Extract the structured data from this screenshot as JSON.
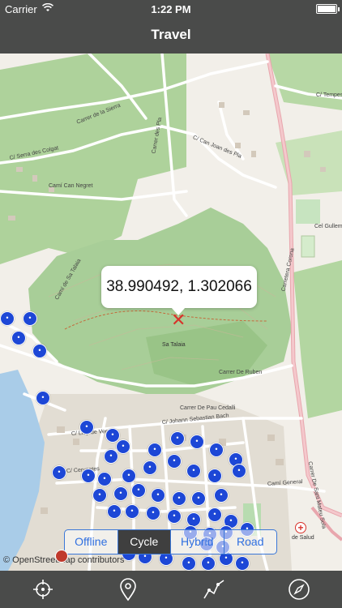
{
  "status_bar": {
    "carrier": "Carrier",
    "time": "1:22 PM",
    "battery_level": 1.0
  },
  "nav": {
    "title": "Travel"
  },
  "map": {
    "coordinates_callout": "38.990492, 1.302066",
    "place_label": "Sa Talaia",
    "street_labels": [
      "Carrer de la Sierra",
      "C/ Serra des Colgat",
      "Camí de Sa Talaia",
      "Carrer des Pla",
      "C/ Can Joan des Pla",
      "Camí Can Negret",
      "C/ Tempesta",
      "Carretera Corona",
      "Carrer De Ruben",
      "Carrer De Pau Cedalli",
      "C/ Johann Sebastian Bach",
      "C/ Llop de Vega",
      "C/ Cervantes",
      "Camí General",
      "Carrer De Sant Mateu Sola",
      "Cel Gullem de Montgrí"
    ],
    "poi_glyph": "•",
    "hospital_label": "de Salud"
  },
  "map_modes": {
    "options": [
      "Offline",
      "Cycle",
      "Hybrid",
      "Road"
    ],
    "selected": "Cycle"
  },
  "attribution": "© OpenStreetMap contributors",
  "tab_icons": [
    "locate-icon",
    "pin-icon",
    "route-icon",
    "compass-icon"
  ],
  "colors": {
    "bar": "#4a4b4a",
    "poi": "#1d47d6",
    "accent": "#2f6fe0",
    "marker": "#d8322b",
    "forest": "#a8ce98"
  }
}
